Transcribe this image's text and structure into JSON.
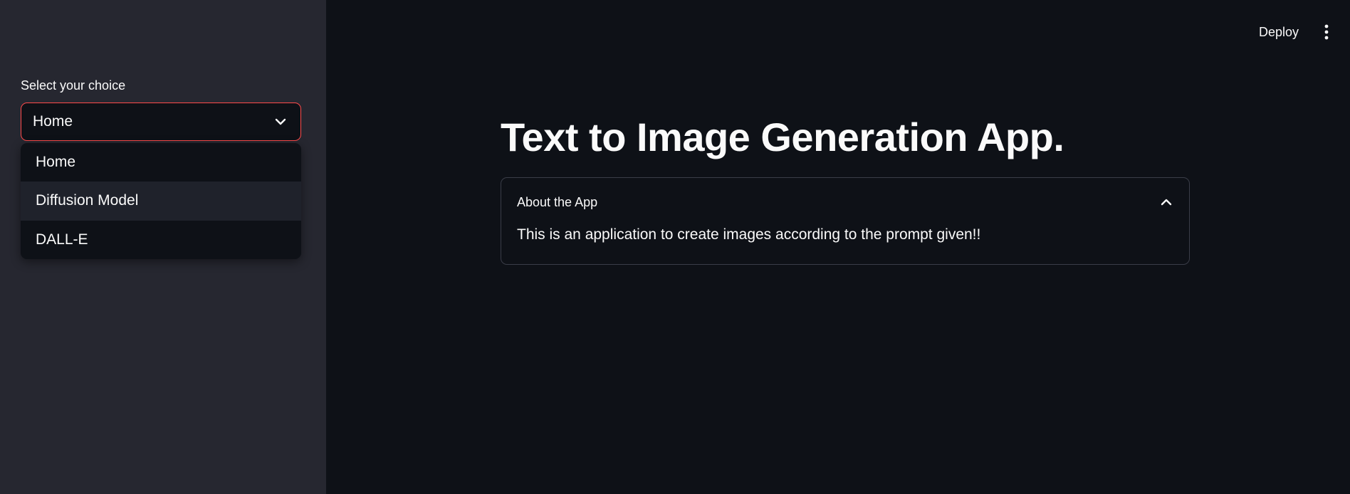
{
  "sidebar": {
    "select_label": "Select your choice",
    "selected_value": "Home",
    "options": [
      {
        "label": "Home"
      },
      {
        "label": "Diffusion Model"
      },
      {
        "label": "DALL-E"
      }
    ],
    "highlighted_option": "Diffusion Model"
  },
  "header": {
    "deploy_label": "Deploy",
    "menu_icon": "kebab-menu-icon"
  },
  "main": {
    "title": "Text to Image Generation App.",
    "expander": {
      "title": "About the App",
      "expanded": true,
      "body": "This is an application to create images according to the prompt given!!"
    }
  },
  "colors": {
    "background": "#0e1117",
    "sidebar": "#262730",
    "accent_border": "#ff4b4b",
    "text": "#fafafa"
  }
}
